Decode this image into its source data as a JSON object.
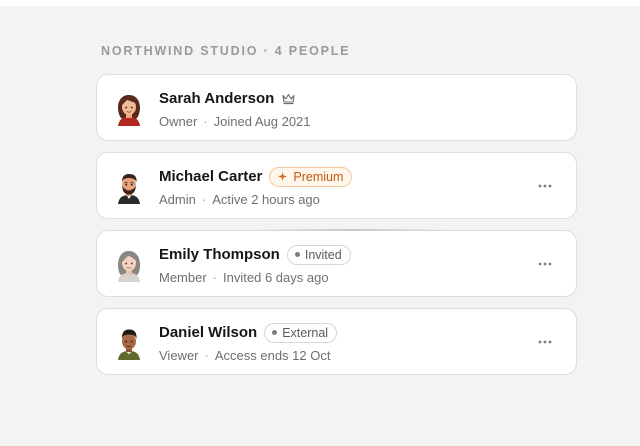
{
  "team": {
    "header": "NORTHWIND STUDIO · 4 PEOPLE"
  },
  "members": [
    {
      "name": "Sarah Anderson",
      "role": "Owner",
      "status": "Joined Aug 2021",
      "avatar_icon": "woman-avatar-icon",
      "marker_icon": "crown-icon"
    },
    {
      "name": "Michael Carter",
      "role": "Admin",
      "status": "Active 2 hours ago",
      "avatar_icon": "bearded-man-avatar-icon",
      "badge": "Premium",
      "badge_icon": "sparkle-icon",
      "menu_icon": "more-horizontal-icon"
    },
    {
      "name": "Emily Thompson",
      "role": "Member",
      "status": "Invited 6 days ago",
      "avatar_icon": "woman-avatar-icon",
      "badge": "Invited",
      "menu_icon": "more-horizontal-icon"
    },
    {
      "name": "Daniel Wilson",
      "role": "Viewer",
      "status": "Access ends 12 Oct",
      "avatar_icon": "man-avatar-icon",
      "badge": "External",
      "menu_icon": "more-horizontal-icon"
    }
  ],
  "separators": {
    "dot": "·"
  },
  "colors": {
    "page_background": "#f3f3f3",
    "card_background": "#ffffff",
    "card_border": "#dedede",
    "premium_text": "#c2580e",
    "premium_background": "#fff6ec",
    "premium_border": "#f2c99c",
    "muted_text": "#6f6f6f"
  }
}
